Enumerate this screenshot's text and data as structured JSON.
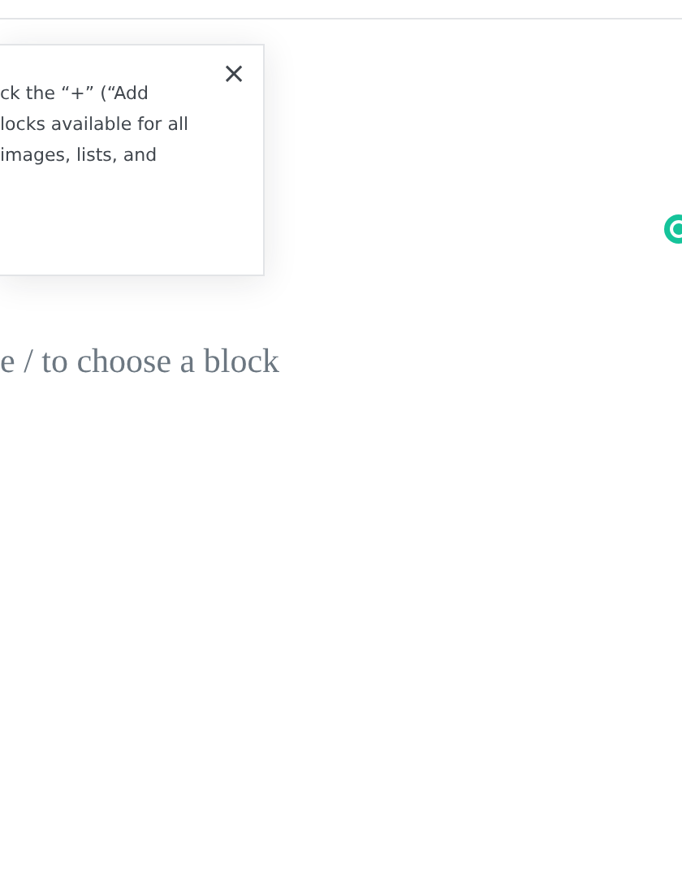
{
  "tip": {
    "lines": [
      "ck the “+” (“Add",
      "locks available for all",
      "images, lists, and"
    ],
    "close": "×"
  },
  "editor": {
    "placeholder": "e / to choose a block"
  }
}
